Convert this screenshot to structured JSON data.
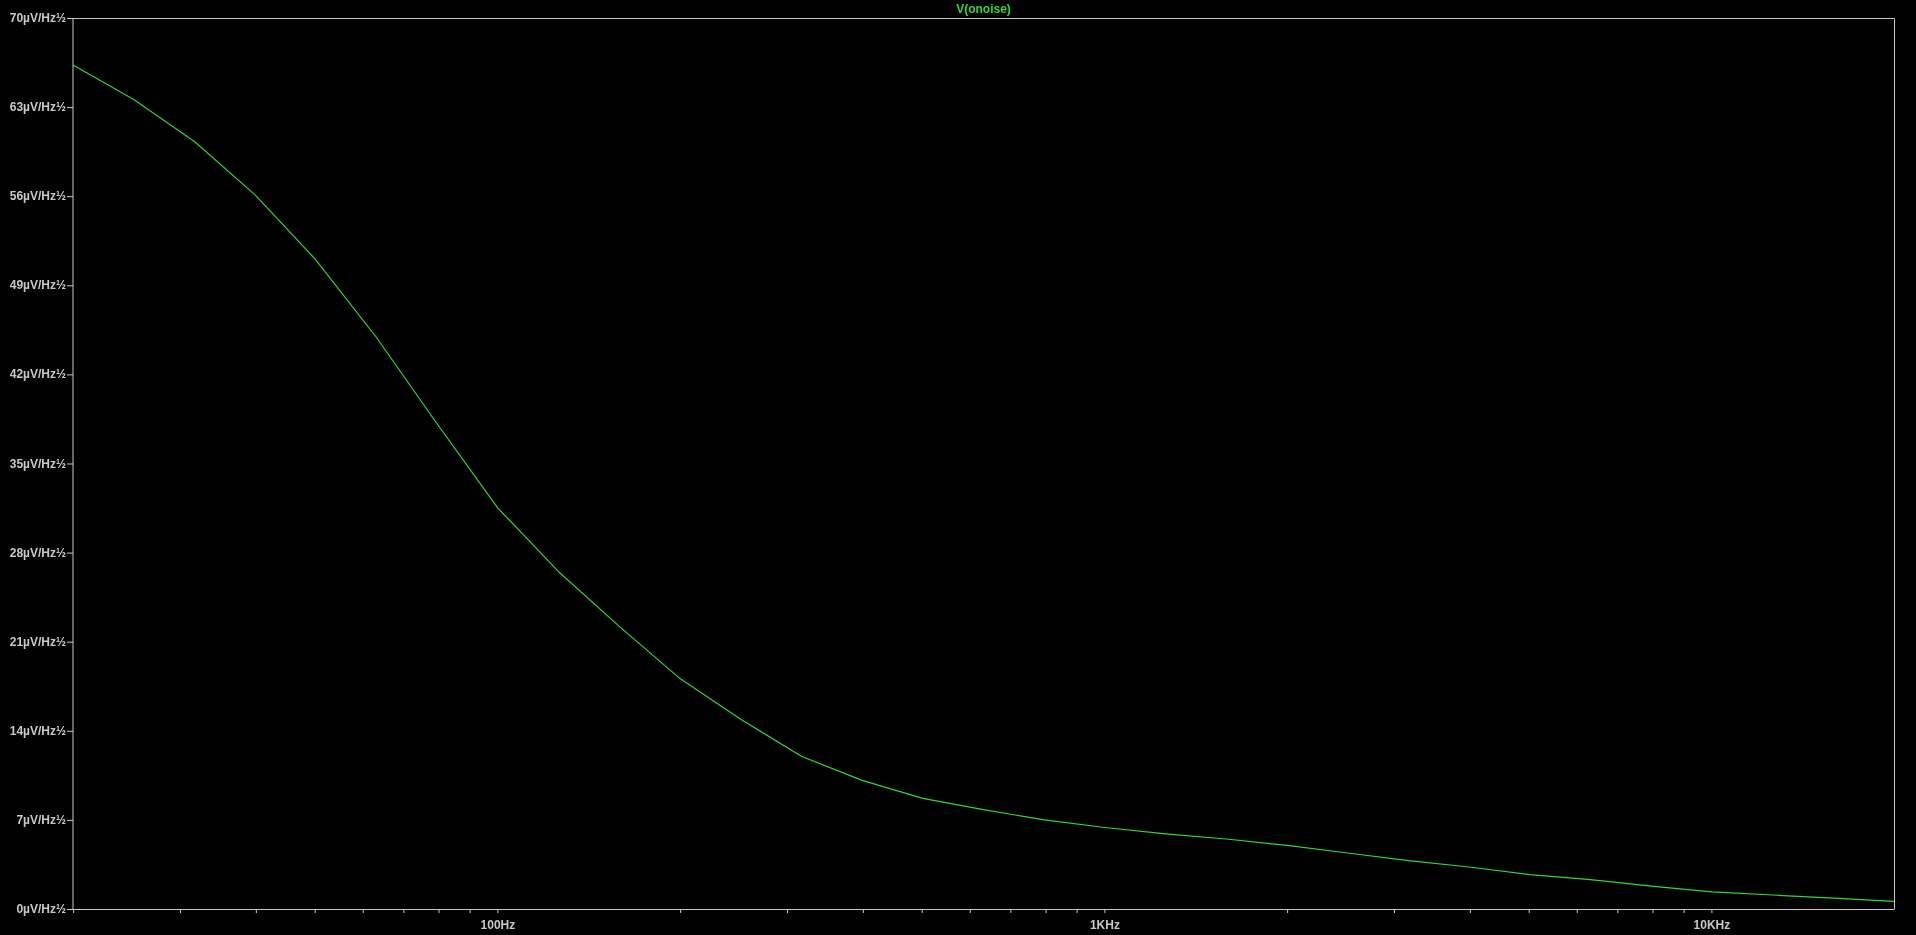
{
  "plot": {
    "chart_data": {
      "type": "line",
      "ylim": [
        0,
        70
      ],
      "categories": [
        null,
        null,
        null,
        null,
        null,
        null,
        null,
        "100Hz",
        null,
        null,
        null,
        null,
        null,
        null,
        null,
        null,
        null,
        "1KHz",
        null,
        null,
        null,
        null,
        null,
        null,
        null,
        null,
        null,
        "10KHz",
        null,
        null,
        null
      ],
      "yticks": [
        {
          "value": 0,
          "label": "0µV/Hz½"
        },
        {
          "value": 7,
          "label": "7µV/Hz½"
        },
        {
          "value": 14,
          "label": "14µV/Hz½"
        },
        {
          "value": 21,
          "label": "21µV/Hz½"
        },
        {
          "value": 28,
          "label": "28µV/Hz½"
        },
        {
          "value": 35,
          "label": "35µV/Hz½"
        },
        {
          "value": 42,
          "label": "42µV/Hz½"
        },
        {
          "value": 49,
          "label": "49µV/Hz½"
        },
        {
          "value": 56,
          "label": "56µV/Hz½"
        },
        {
          "value": 63,
          "label": "63µV/Hz½"
        },
        {
          "value": 70,
          "label": "70µV/Hz½"
        }
      ],
      "series": [
        {
          "name": "V(onoise)",
          "color": "#33d633",
          "values": [
            66.3,
            63.6,
            60.3,
            56.1,
            51.0,
            44.9,
            38.1,
            31.5,
            26.5,
            22.2,
            18.1,
            14.9,
            12.0,
            10.1,
            8.7,
            7.8,
            7.0,
            6.4,
            5.9,
            5.5,
            5.0,
            4.4,
            3.8,
            3.3,
            2.7,
            2.3,
            1.8,
            1.35,
            1.1,
            0.85,
            0.6
          ]
        }
      ]
    }
  }
}
